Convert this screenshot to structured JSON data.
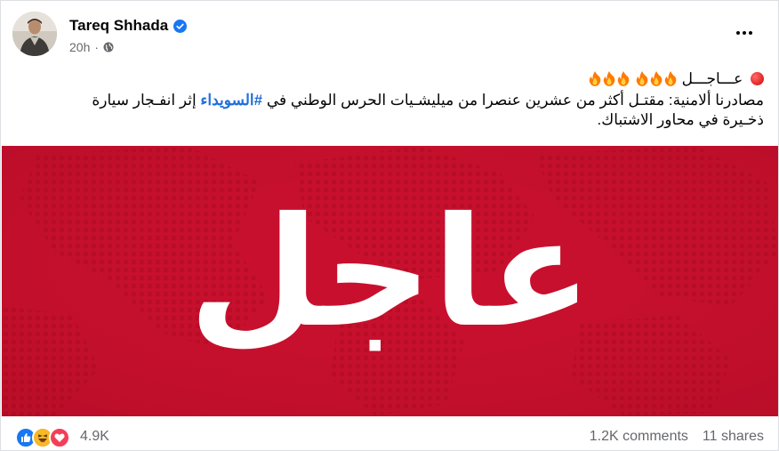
{
  "post": {
    "author": "Tareq Shhada",
    "time": "20h",
    "headline": "عـــاجـــل",
    "text_line2_start": "مصادرنا ألامنية:  مقتـل أكثر من عشرين عنصرا من ميليشـيات الحرس الوطني في ",
    "hashtag": "#السويداء",
    "text_line2_end": " إثر انفـجار سيارة",
    "text_line3": "ذخـيرة في محاور الاشتباك."
  },
  "image": {
    "word": "عاجل",
    "background": "#c8102e"
  },
  "footer": {
    "reactions_count": "4.9K",
    "comments": "1.2K comments",
    "shares": "11 shares"
  },
  "icons": {
    "globe": "globe-icon",
    "verified": "verified-badge-icon",
    "more": "more-options-icon"
  }
}
